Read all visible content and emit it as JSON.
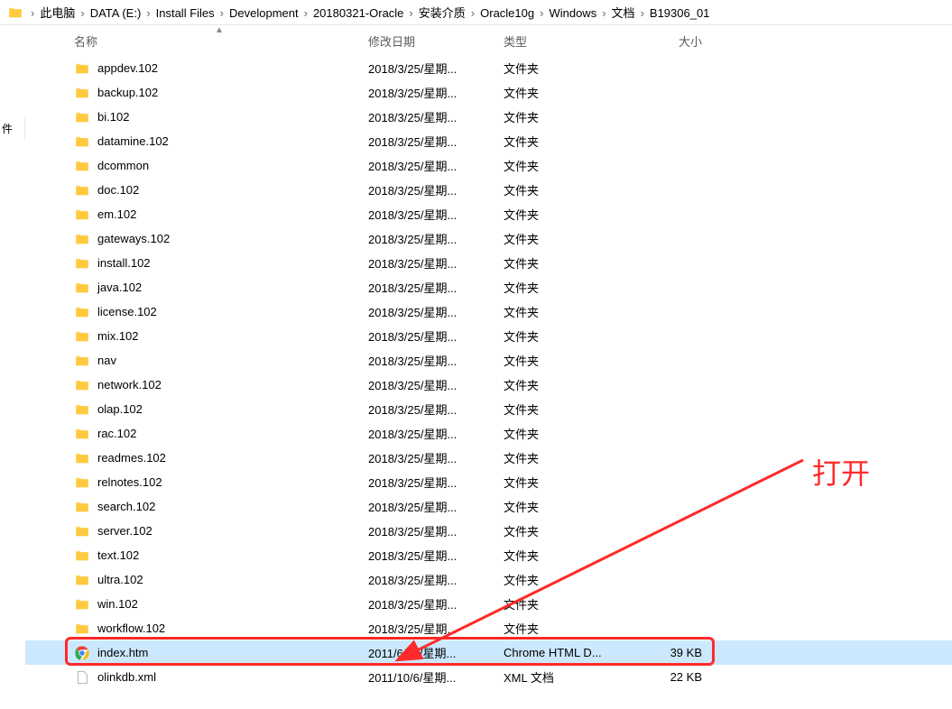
{
  "breadcrumb": {
    "items": [
      "此电脑",
      "DATA (E:)",
      "Install Files",
      "Development",
      "20180321-Oracle",
      "安装介质",
      "Oracle10g",
      "Windows",
      "文档",
      "B19306_01"
    ]
  },
  "sidebar": {
    "fragment_label": "件"
  },
  "columns": {
    "name": "名称",
    "date": "修改日期",
    "type": "类型",
    "size": "大小"
  },
  "files": [
    {
      "name": "appdev.102",
      "date": "2018/3/25/星期...",
      "type": "文件夹",
      "size": "",
      "icon": "folder"
    },
    {
      "name": "backup.102",
      "date": "2018/3/25/星期...",
      "type": "文件夹",
      "size": "",
      "icon": "folder"
    },
    {
      "name": "bi.102",
      "date": "2018/3/25/星期...",
      "type": "文件夹",
      "size": "",
      "icon": "folder"
    },
    {
      "name": "datamine.102",
      "date": "2018/3/25/星期...",
      "type": "文件夹",
      "size": "",
      "icon": "folder"
    },
    {
      "name": "dcommon",
      "date": "2018/3/25/星期...",
      "type": "文件夹",
      "size": "",
      "icon": "folder"
    },
    {
      "name": "doc.102",
      "date": "2018/3/25/星期...",
      "type": "文件夹",
      "size": "",
      "icon": "folder"
    },
    {
      "name": "em.102",
      "date": "2018/3/25/星期...",
      "type": "文件夹",
      "size": "",
      "icon": "folder"
    },
    {
      "name": "gateways.102",
      "date": "2018/3/25/星期...",
      "type": "文件夹",
      "size": "",
      "icon": "folder"
    },
    {
      "name": "install.102",
      "date": "2018/3/25/星期...",
      "type": "文件夹",
      "size": "",
      "icon": "folder"
    },
    {
      "name": "java.102",
      "date": "2018/3/25/星期...",
      "type": "文件夹",
      "size": "",
      "icon": "folder"
    },
    {
      "name": "license.102",
      "date": "2018/3/25/星期...",
      "type": "文件夹",
      "size": "",
      "icon": "folder"
    },
    {
      "name": "mix.102",
      "date": "2018/3/25/星期...",
      "type": "文件夹",
      "size": "",
      "icon": "folder"
    },
    {
      "name": "nav",
      "date": "2018/3/25/星期...",
      "type": "文件夹",
      "size": "",
      "icon": "folder"
    },
    {
      "name": "network.102",
      "date": "2018/3/25/星期...",
      "type": "文件夹",
      "size": "",
      "icon": "folder"
    },
    {
      "name": "olap.102",
      "date": "2018/3/25/星期...",
      "type": "文件夹",
      "size": "",
      "icon": "folder"
    },
    {
      "name": "rac.102",
      "date": "2018/3/25/星期...",
      "type": "文件夹",
      "size": "",
      "icon": "folder"
    },
    {
      "name": "readmes.102",
      "date": "2018/3/25/星期...",
      "type": "文件夹",
      "size": "",
      "icon": "folder"
    },
    {
      "name": "relnotes.102",
      "date": "2018/3/25/星期...",
      "type": "文件夹",
      "size": "",
      "icon": "folder"
    },
    {
      "name": "search.102",
      "date": "2018/3/25/星期...",
      "type": "文件夹",
      "size": "",
      "icon": "folder"
    },
    {
      "name": "server.102",
      "date": "2018/3/25/星期...",
      "type": "文件夹",
      "size": "",
      "icon": "folder"
    },
    {
      "name": "text.102",
      "date": "2018/3/25/星期...",
      "type": "文件夹",
      "size": "",
      "icon": "folder"
    },
    {
      "name": "ultra.102",
      "date": "2018/3/25/星期...",
      "type": "文件夹",
      "size": "",
      "icon": "folder"
    },
    {
      "name": "win.102",
      "date": "2018/3/25/星期...",
      "type": "文件夹",
      "size": "",
      "icon": "folder"
    },
    {
      "name": "workflow.102",
      "date": "2018/3/25/星期...",
      "type": "文件夹",
      "size": "",
      "icon": "folder"
    },
    {
      "name": "index.htm",
      "date": "2011/6/23/星期...",
      "type": "Chrome HTML D...",
      "size": "39 KB",
      "icon": "chrome",
      "selected": true,
      "highlighted": true
    },
    {
      "name": "olinkdb.xml",
      "date": "2011/10/6/星期...",
      "type": "XML 文档",
      "size": "22 KB",
      "icon": "file"
    }
  ],
  "annotation": {
    "label": "打开"
  }
}
